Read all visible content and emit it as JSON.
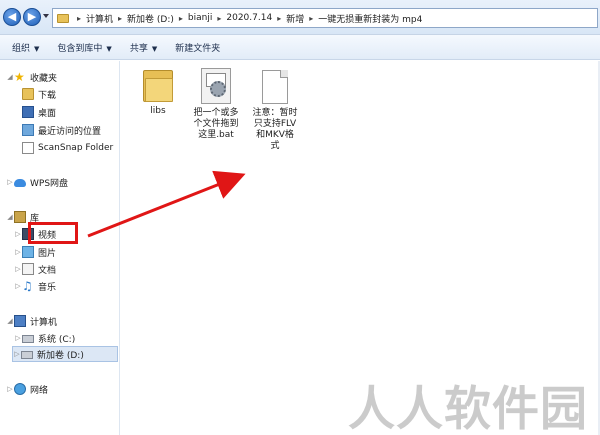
{
  "address_bar": {
    "breadcrumbs": [
      "计算机",
      "新加卷 (D:)",
      "bianji",
      "2020.7.14",
      "新增",
      "一键无损重新封装为 mp4"
    ],
    "separator": "▸"
  },
  "toolbar": {
    "organize": "组织",
    "include_in_library": "包含到库中",
    "share": "共享",
    "new_folder": "新建文件夹",
    "dropdown_glyph": "▼"
  },
  "nav": {
    "favorites": {
      "label": "收藏夹",
      "items": [
        "下载",
        "桌面",
        "最近访问的位置",
        "ScanSnap Folder"
      ]
    },
    "wps": "WPS网盘",
    "libraries": {
      "label": "库",
      "items": [
        "视频",
        "图片",
        "文档",
        "音乐"
      ]
    },
    "computer": {
      "label": "计算机",
      "items": [
        "系统 (C:)",
        "新加卷 (D:)"
      ]
    },
    "network": "网络"
  },
  "files": [
    {
      "name": "libs",
      "kind": "folder-icon"
    },
    {
      "name": "把一个或多个文件拖到这里.bat",
      "lines": [
        "把一个或多",
        "个文件拖到",
        "这里.bat"
      ],
      "kind": "bat-file-icon"
    },
    {
      "name": "注意：暂时只支持FLV和MKV格式",
      "lines": [
        "注意：暂时",
        "只支持FLV",
        "和MKV格",
        "式"
      ],
      "kind": "text-file-icon"
    }
  ],
  "annotation": {
    "highlight_color": "#e01616"
  },
  "watermark": "人人软件园",
  "colors": {
    "accent": "#1f5fb8",
    "toolbar_text": "#1e2f4d",
    "selection": "#dce7f5"
  }
}
